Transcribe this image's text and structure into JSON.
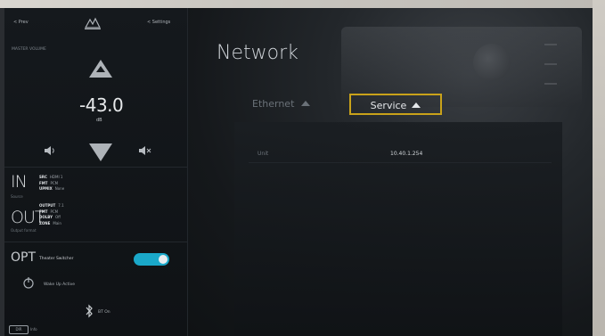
{
  "topbar": {
    "left_label": "< Prev",
    "center_icon": "brand-logo",
    "right_label": "< Settings"
  },
  "volume": {
    "label": "MASTER VOLUME",
    "value": "-43.0",
    "unit": "dB"
  },
  "input": {
    "big": "IN",
    "small": "Source",
    "lines": [
      {
        "k": "SRC",
        "v": "HDMI 1"
      },
      {
        "k": "FMT",
        "v": "PCM"
      },
      {
        "k": "UPMIX",
        "v": "None"
      }
    ]
  },
  "output": {
    "big": "OUT",
    "small": "Output format",
    "lines": [
      {
        "k": "OUTPUT",
        "v": "7.1"
      },
      {
        "k": "FMT",
        "v": "PCM"
      },
      {
        "k": "DOLBY",
        "v": "Off"
      },
      {
        "k": "ZONE",
        "v": "Main"
      }
    ]
  },
  "opt": {
    "big": "OPT",
    "label": "Theater Switcher",
    "toggle_on": true
  },
  "wakeup": {
    "label": "Wake Up   Active"
  },
  "bluetooth": {
    "label": "BT   On"
  },
  "badge": {
    "label": "DIR",
    "text": "Info"
  },
  "network": {
    "title": "Network",
    "tabs": [
      {
        "label": "Ethernet"
      },
      {
        "label": "Service"
      }
    ],
    "rows": [
      {
        "name": "Unit",
        "value": "10.40.1.254"
      }
    ]
  },
  "colors": {
    "accent": "#1aa8c9",
    "highlight": "#c9a21a"
  }
}
